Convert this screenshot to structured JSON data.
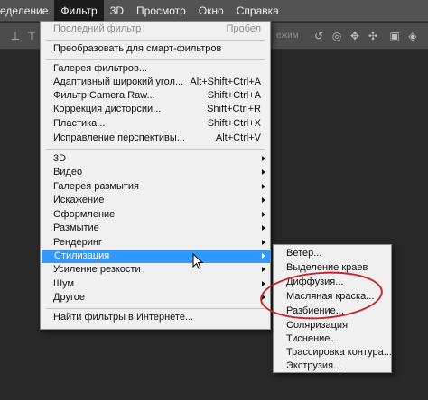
{
  "menubar": {
    "items": [
      {
        "label": "еделение"
      },
      {
        "label": "Фильтр"
      },
      {
        "label": "3D"
      },
      {
        "label": "Просмотр"
      },
      {
        "label": "Окно"
      },
      {
        "label": "Справка"
      }
    ]
  },
  "optbar": {
    "text_right": "ежим"
  },
  "filter_menu": {
    "last_filter": {
      "label": "Последний фильтр",
      "shortcut": "Пробел"
    },
    "smart": {
      "label": "Преобразовать для смарт-фильтров"
    },
    "gallery": {
      "label": "Галерея фильтров..."
    },
    "wide_angle": {
      "label": "Адаптивный широкий угол...",
      "shortcut": "Alt+Shift+Ctrl+A"
    },
    "camera_raw": {
      "label": "Фильтр Camera Raw...",
      "shortcut": "Shift+Ctrl+A"
    },
    "lens": {
      "label": "Коррекция дисторсии...",
      "shortcut": "Shift+Ctrl+R"
    },
    "liquify": {
      "label": "Пластика...",
      "shortcut": "Shift+Ctrl+X"
    },
    "vanishing": {
      "label": "Исправление перспективы...",
      "shortcut": "Alt+Ctrl+V"
    },
    "sub3d": {
      "label": "3D"
    },
    "video": {
      "label": "Видео"
    },
    "blur_gallery": {
      "label": "Галерея размытия"
    },
    "distort": {
      "label": "Искажение"
    },
    "pixelate": {
      "label": "Оформление"
    },
    "blur": {
      "label": "Размытие"
    },
    "render": {
      "label": "Рендеринг"
    },
    "stylize": {
      "label": "Стилизация"
    },
    "sharpen": {
      "label": "Усиление резкости"
    },
    "noise": {
      "label": "Шум"
    },
    "other": {
      "label": "Другое"
    },
    "online": {
      "label": "Найти фильтры в Интернете..."
    }
  },
  "stylize_submenu": {
    "items": [
      {
        "label": "Ветер..."
      },
      {
        "label": "Выделение краев"
      },
      {
        "label": "Диффузия..."
      },
      {
        "label": "Масляная краска..."
      },
      {
        "label": "Разбиение..."
      },
      {
        "label": "Соляризация"
      },
      {
        "label": "Тиснение..."
      },
      {
        "label": "Трассировка контура..."
      },
      {
        "label": "Экструзия..."
      }
    ]
  },
  "colors": {
    "highlight": "#3399ff",
    "annotation": "#c8242b",
    "menubar": "#535353"
  }
}
